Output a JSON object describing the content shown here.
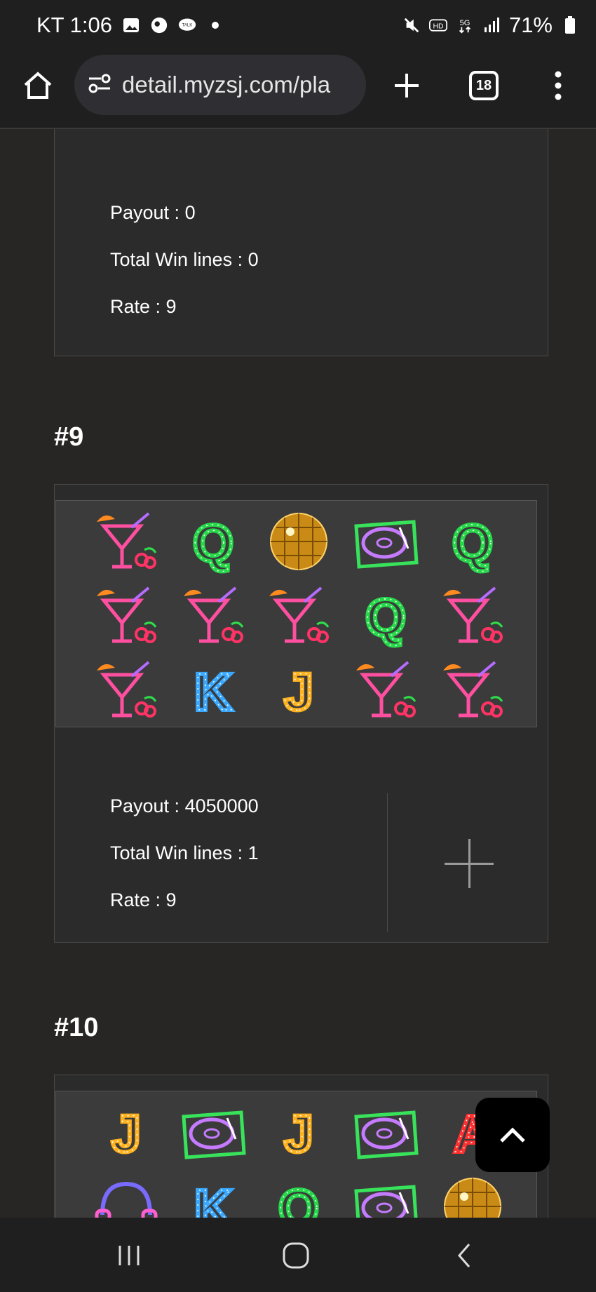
{
  "status_bar": {
    "carrier_time": "KT 1:06",
    "notification_icons": [
      "gallery-icon",
      "chat-icon",
      "talk-icon",
      "dot-icon"
    ],
    "system_icons": [
      "mute-icon",
      "hd-icon",
      "5g-icon",
      "signal-icon",
      "battery-icon"
    ],
    "battery_percent": "71%"
  },
  "browser": {
    "url": "detail.myzsj.com/pla",
    "tab_count": "18"
  },
  "sections": [
    {
      "payout": "Payout : 0",
      "win_lines": "Total Win lines : 0",
      "rate": "Rate : 9"
    },
    {
      "title": "#9",
      "payout": "Payout : 4050000",
      "win_lines": "Total Win lines : 1",
      "rate": "Rate : 9",
      "reels": [
        [
          "cocktail",
          "Q",
          "disco-ball",
          "turntable",
          "Q"
        ],
        [
          "cocktail",
          "cocktail",
          "cocktail",
          "Q",
          "cocktail"
        ],
        [
          "cocktail",
          "K",
          "J",
          "cocktail",
          "cocktail"
        ]
      ]
    },
    {
      "title": "#10",
      "reels": [
        [
          "J",
          "turntable",
          "J",
          "turntable",
          "A"
        ],
        [
          "headphones",
          "K",
          "Q",
          "turntable",
          "disco-ball"
        ]
      ]
    }
  ],
  "colors": {
    "background": "#272625",
    "card": "#2c2b2c",
    "q_green": "#27d94a",
    "k_blue": "#3aa8ff",
    "j_gold": "#ffb21f",
    "a_red": "#ff3030",
    "cocktail_pink": "#ff4fa0"
  }
}
